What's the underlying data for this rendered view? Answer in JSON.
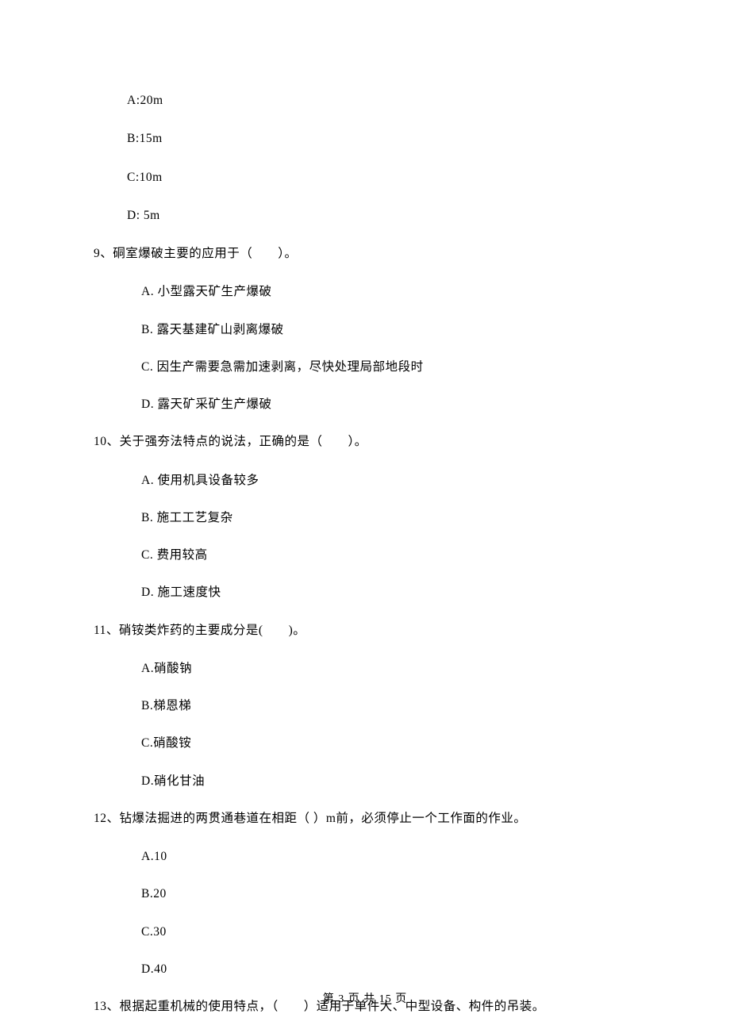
{
  "top_options": {
    "a": "A:20m",
    "b": "B:15m",
    "c": "C:10m",
    "d": "D: 5m"
  },
  "q9": {
    "text": "9、硐室爆破主要的应用于（　　）。",
    "a": "A.  小型露天矿生产爆破",
    "b": "B.  露天基建矿山剥离爆破",
    "c": "C.  因生产需要急需加速剥离，尽快处理局部地段时",
    "d": "D.  露天矿采矿生产爆破"
  },
  "q10": {
    "text": "10、关于强夯法特点的说法，正确的是（　　）。",
    "a": "A.  使用机具设备较多",
    "b": "B.  施工工艺复杂",
    "c": "C.  费用较高",
    "d": "D.  施工速度快"
  },
  "q11": {
    "text": "11、硝铵类炸药的主要成分是(　　)。",
    "a": "A.硝酸钠",
    "b": "B.梯恩梯",
    "c": "C.硝酸铵",
    "d": "D.硝化甘油"
  },
  "q12": {
    "text": "12、钻爆法掘进的两贯通巷道在相距（  ）m前，必须停止一个工作面的作业。",
    "a": "A.10",
    "b": "B.20",
    "c": "C.30",
    "d": "D.40"
  },
  "q13": {
    "text": "13、根据起重机械的使用特点，（　　）适用于单件大、中型设备、构件的吊装。"
  },
  "footer": "第 3 页 共 15 页"
}
